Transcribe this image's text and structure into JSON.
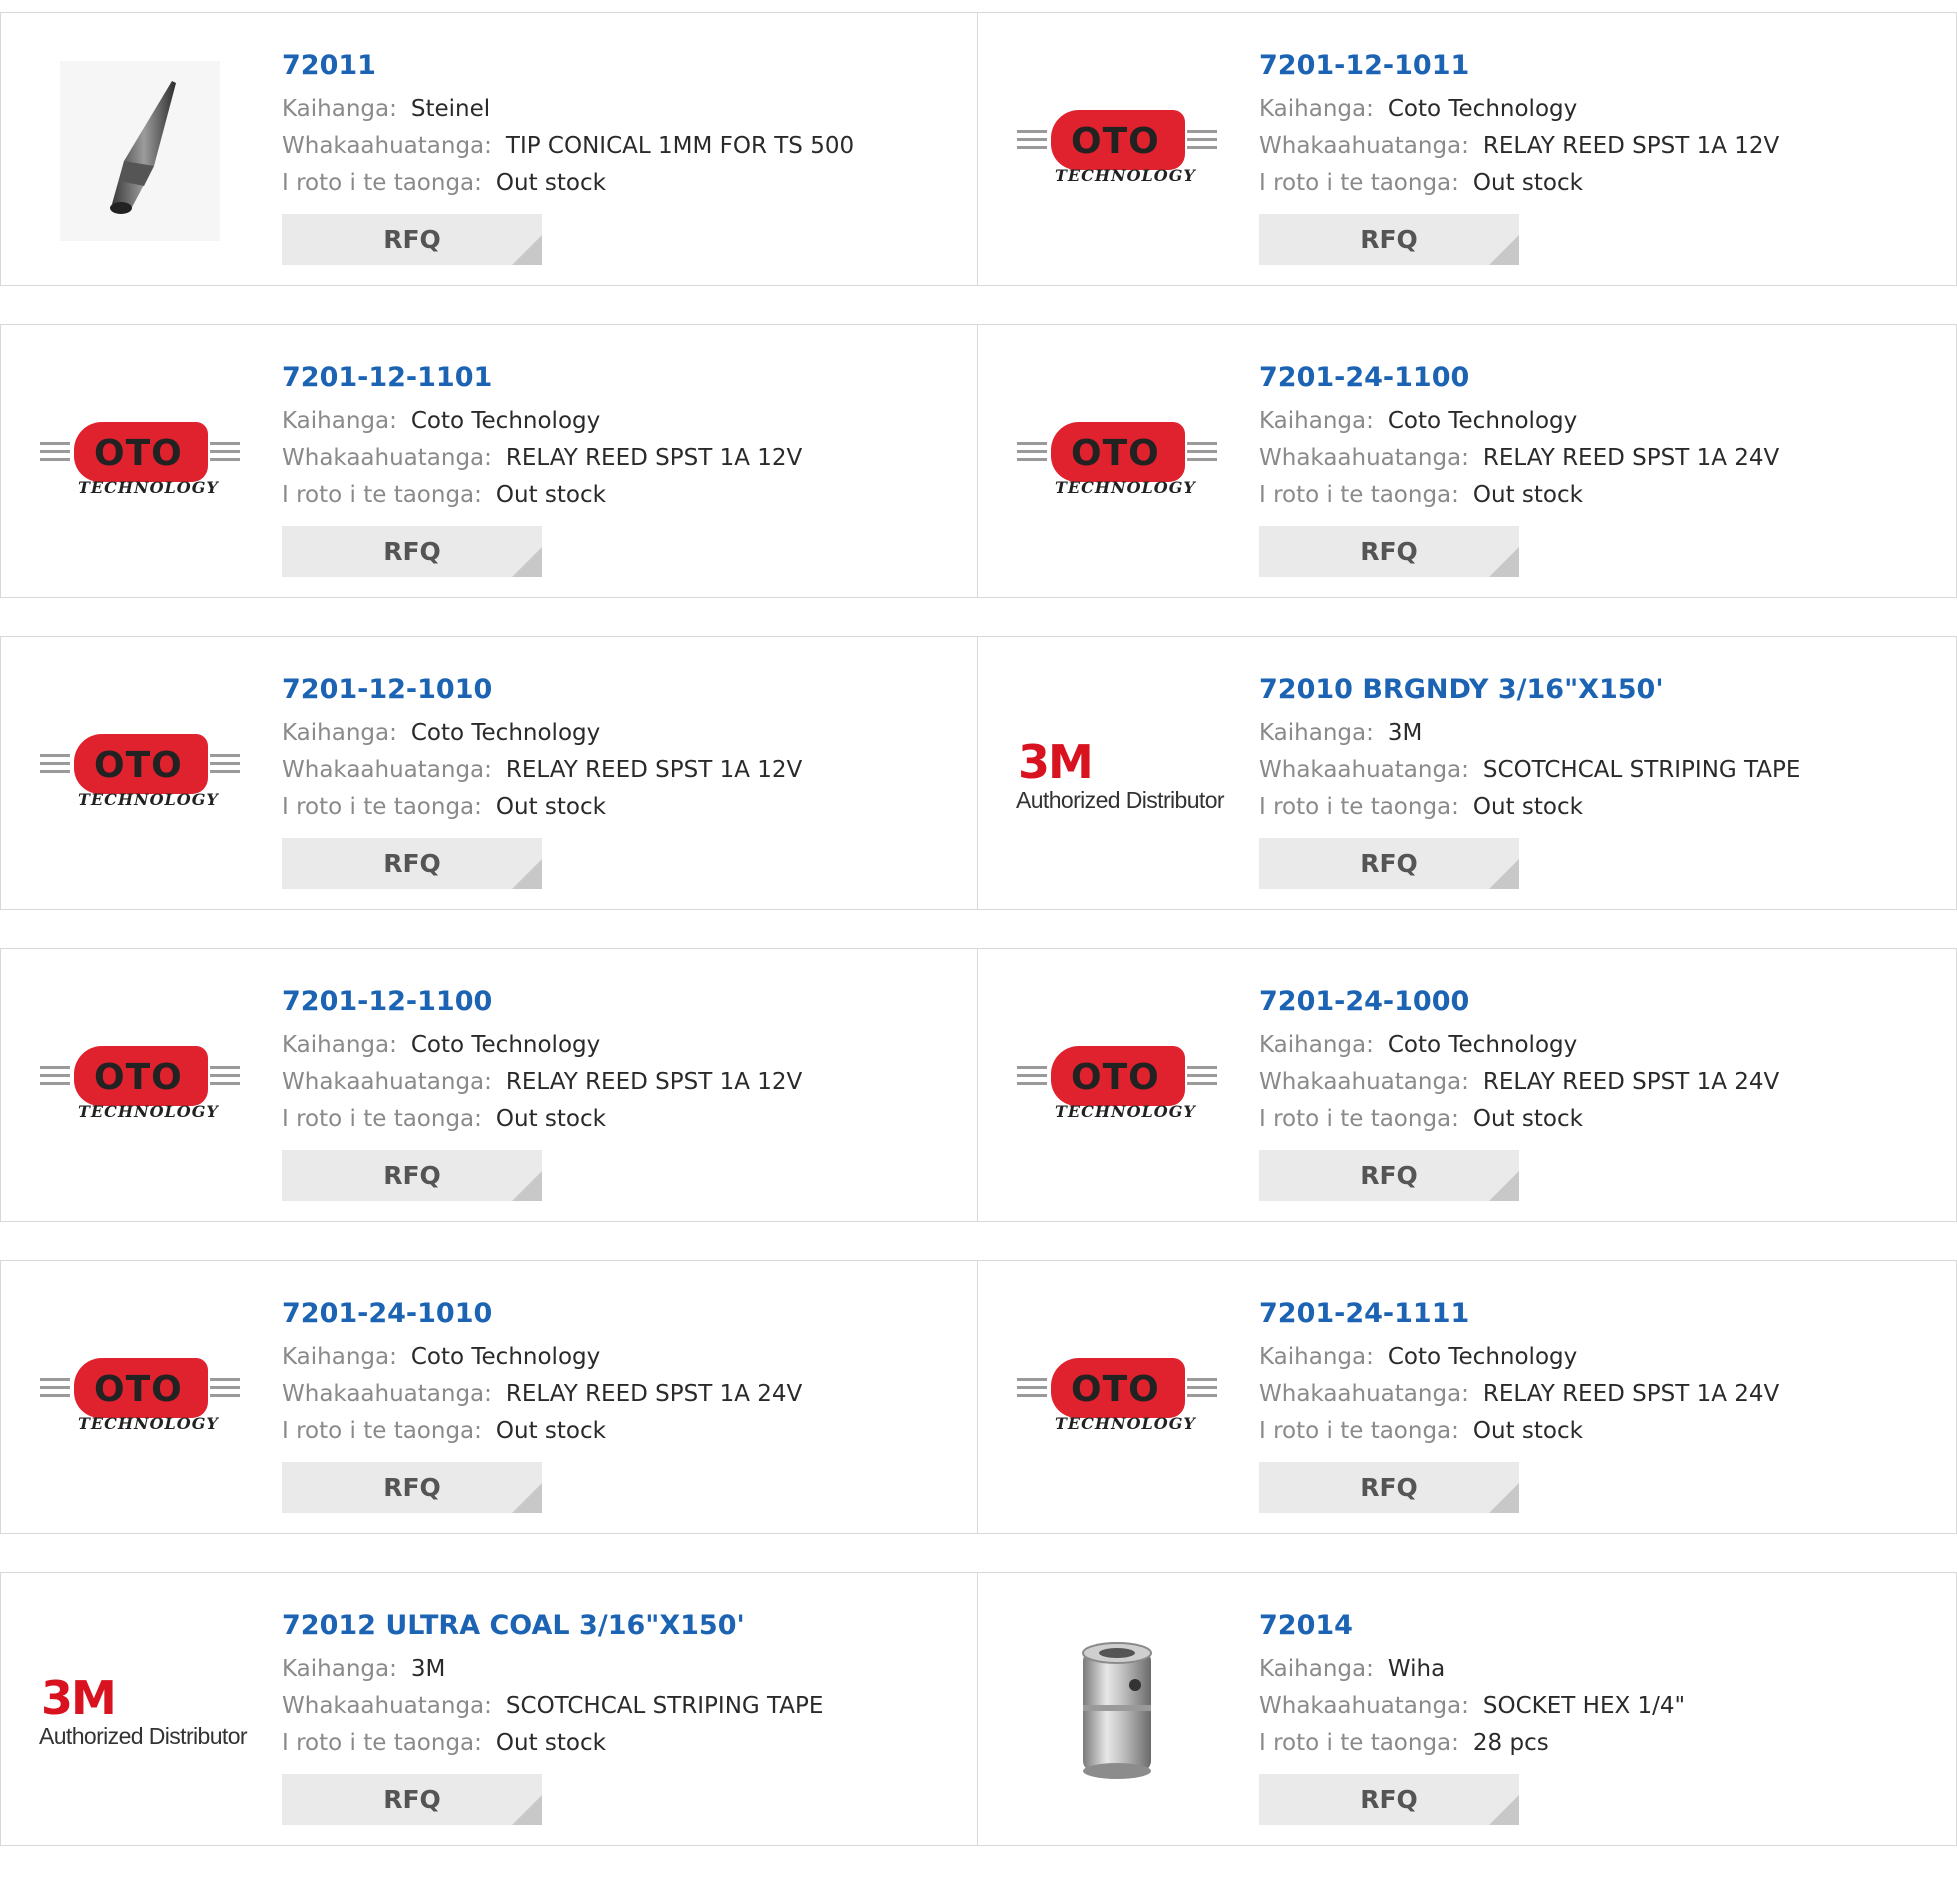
{
  "labels": {
    "manufacturer": "Kaihanga:",
    "description": "Whakaahuatanga:",
    "stock": "I roto i te taonga:",
    "rfq": "RFQ"
  },
  "logos": {
    "coto_word": "OTO",
    "coto_sub": "TECHNOLOGY",
    "m3_mark": "3M",
    "m3_text": "Authorized Distributor"
  },
  "products": [
    {
      "part": "72011",
      "manufacturer": "Steinel",
      "description": "TIP CONICAL 1MM FOR TS 500",
      "stock": "Out stock",
      "image": "conical-tip-image"
    },
    {
      "part": "7201-12-1011",
      "manufacturer": "Coto Technology",
      "description": "RELAY REED SPST 1A 12V",
      "stock": "Out stock",
      "image": "coto-logo"
    },
    {
      "part": "7201-12-1101",
      "manufacturer": "Coto Technology",
      "description": "RELAY REED SPST 1A 12V",
      "stock": "Out stock",
      "image": "coto-logo"
    },
    {
      "part": "7201-24-1100",
      "manufacturer": "Coto Technology",
      "description": "RELAY REED SPST 1A 24V",
      "stock": "Out stock",
      "image": "coto-logo"
    },
    {
      "part": "7201-12-1010",
      "manufacturer": "Coto Technology",
      "description": "RELAY REED SPST 1A 12V",
      "stock": "Out stock",
      "image": "coto-logo"
    },
    {
      "part": "72010 BRGNDY 3/16\"X150'",
      "manufacturer": "3M",
      "description": "SCOTCHCAL STRIPING TAPE",
      "stock": "Out stock",
      "image": "3m-logo"
    },
    {
      "part": "7201-12-1100",
      "manufacturer": "Coto Technology",
      "description": "RELAY REED SPST 1A 12V",
      "stock": "Out stock",
      "image": "coto-logo"
    },
    {
      "part": "7201-24-1000",
      "manufacturer": "Coto Technology",
      "description": "RELAY REED SPST 1A 24V",
      "stock": "Out stock",
      "image": "coto-logo"
    },
    {
      "part": "7201-24-1010",
      "manufacturer": "Coto Technology",
      "description": "RELAY REED SPST 1A 24V",
      "stock": "Out stock",
      "image": "coto-logo"
    },
    {
      "part": "7201-24-1111",
      "manufacturer": "Coto Technology",
      "description": "RELAY REED SPST 1A 24V",
      "stock": "Out stock",
      "image": "coto-logo"
    },
    {
      "part": "72012 ULTRA COAL 3/16\"X150'",
      "manufacturer": "3M",
      "description": "SCOTCHCAL STRIPING TAPE",
      "stock": "Out stock",
      "image": "3m-logo"
    },
    {
      "part": "72014",
      "manufacturer": "Wiha",
      "description": "SOCKET HEX 1/4\"",
      "stock": "28 pcs",
      "image": "hex-socket-image"
    }
  ],
  "colors": {
    "link": "#1c64b3",
    "label": "#8a8a8a",
    "button_bg": "#eaeaea",
    "coto_red": "#e0222f",
    "m3_red": "#d8121e"
  }
}
